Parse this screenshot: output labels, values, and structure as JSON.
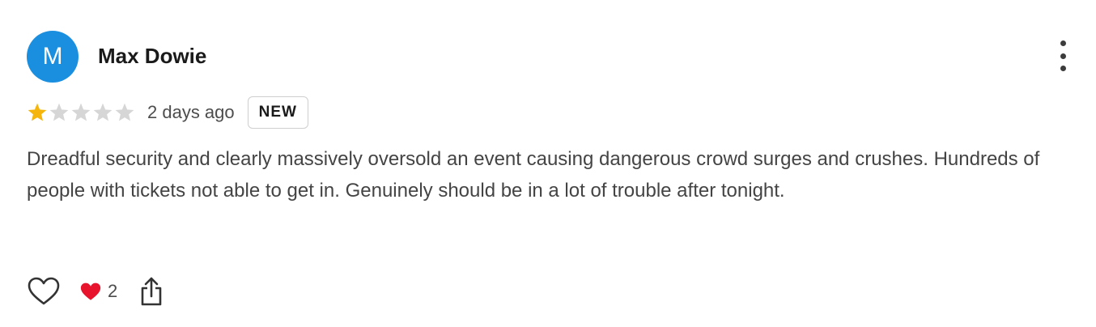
{
  "review": {
    "avatar_initial": "M",
    "avatar_color": "#1a8fe0",
    "author_name": "Max Dowie",
    "rating": 1,
    "rating_max": 5,
    "star_filled_color": "#f5b50a",
    "star_empty_color": "#d6d6d6",
    "time_ago": "2 days ago",
    "badge": "NEW",
    "text": "Dreadful security and clearly massively oversold an event causing dangerous crowd surges and crushes. Hundreds of people with tickets not able to get in. Genuinely should be in a lot of trouble after tonight.",
    "reaction_count": "2",
    "icons": {
      "more": "more-vertical-icon",
      "like": "heart-outline-icon",
      "reaction": "red-heart-icon",
      "share": "share-icon"
    }
  }
}
